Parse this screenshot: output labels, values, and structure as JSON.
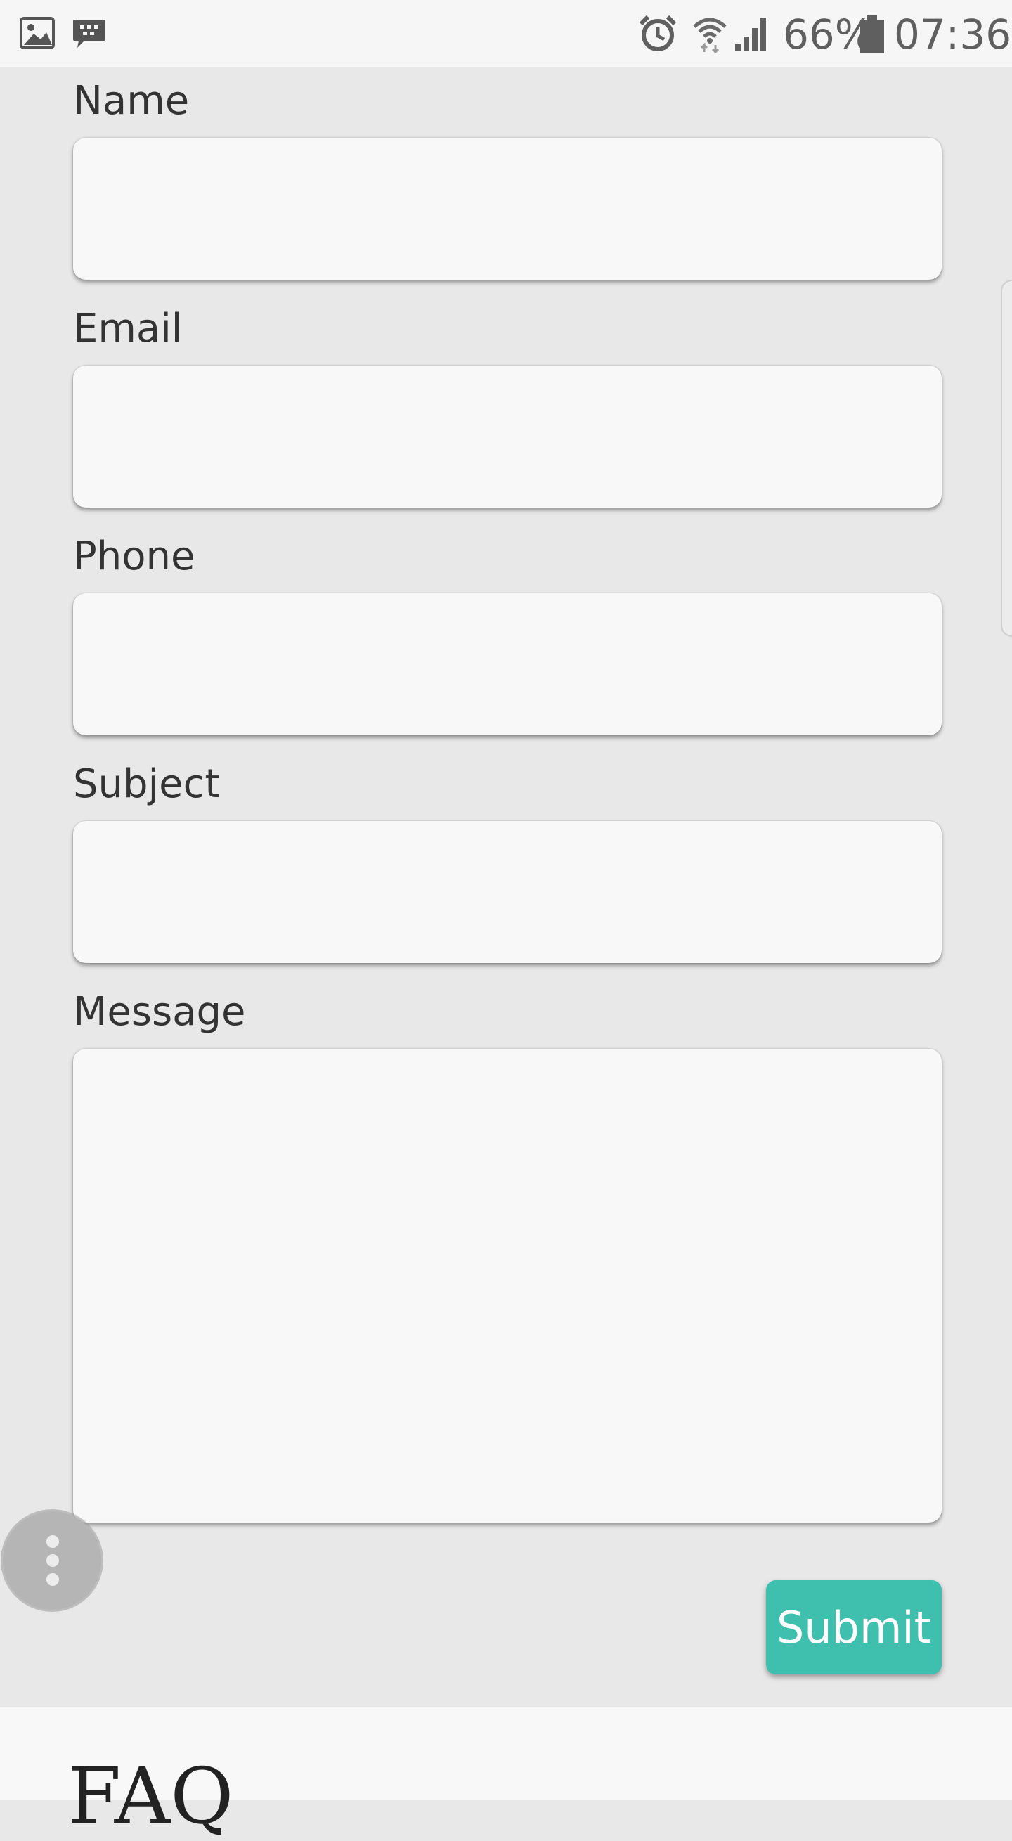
{
  "status_bar": {
    "icons_left": [
      "image-icon",
      "message-icon"
    ],
    "icons_right": [
      "alarm-icon",
      "wifi-icon",
      "signal-icon",
      "battery-icon"
    ],
    "battery": "66%",
    "time": "07:36"
  },
  "form": {
    "fields": [
      {
        "label": "Name",
        "value": ""
      },
      {
        "label": "Email",
        "value": ""
      },
      {
        "label": "Phone",
        "value": ""
      },
      {
        "label": "Subject",
        "value": ""
      },
      {
        "label": "Message",
        "value": ""
      }
    ],
    "submit_label": "Submit"
  },
  "faq": {
    "title": "FAQ"
  },
  "colors": {
    "accent": "#3fbfae",
    "background": "#e8e8e8",
    "field": "#f8f8f8"
  }
}
